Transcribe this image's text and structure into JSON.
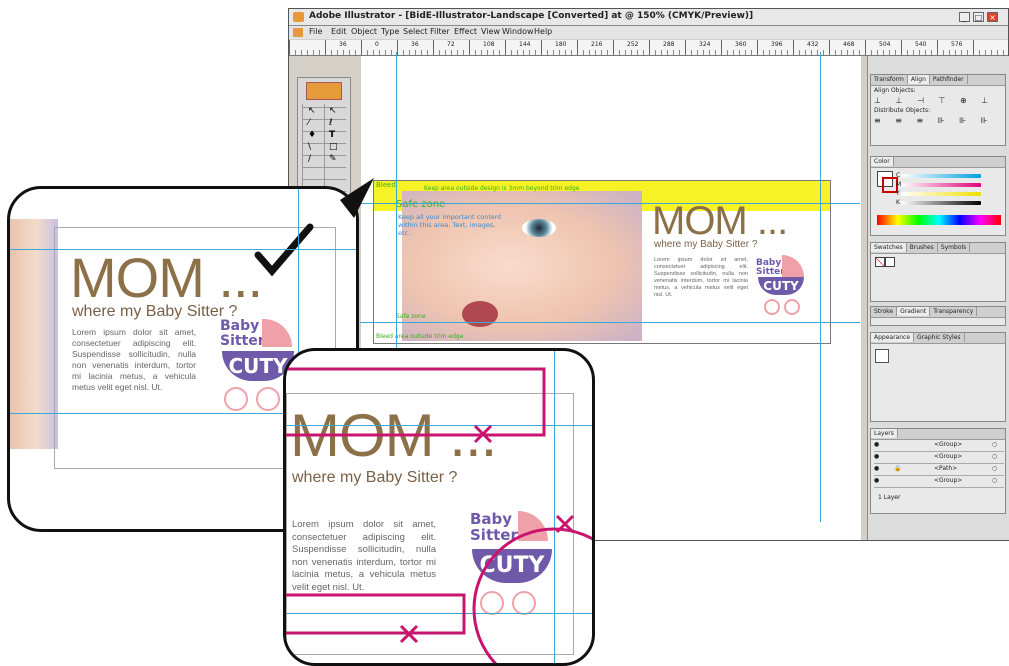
{
  "window": {
    "title": "Adobe Illustrator - [BidE-Illustrator-Landscape [Converted] at @ 150% (CMYK/Preview)]",
    "menus": [
      "File",
      "Edit",
      "Object",
      "Type",
      "Select",
      "Filter",
      "Effect",
      "View",
      "Window",
      "Help"
    ],
    "ruler_ticks": [
      "36",
      "0",
      "36",
      "72",
      "108",
      "144",
      "180",
      "216",
      "252",
      "288",
      "324",
      "360",
      "396",
      "432",
      "468",
      "504",
      "540",
      "576"
    ]
  },
  "panels": {
    "align": {
      "tabs": [
        "Transform",
        "Align",
        "Pathfinder"
      ],
      "align_objects": "Align Objects:",
      "distribute_objects": "Distribute Objects:"
    },
    "color": {
      "tab": "Color",
      "channels": [
        "C",
        "M",
        "Y",
        "K"
      ]
    },
    "swatches": {
      "tabs": [
        "Swatches",
        "Brushes",
        "Symbols"
      ]
    },
    "stroke": {
      "tabs": [
        "Stroke",
        "Gradient",
        "Transparency"
      ]
    },
    "appearance": {
      "tabs": [
        "Appearance",
        "Graphic Styles"
      ]
    },
    "layers": {
      "tab": "Layers",
      "rows": [
        "<Group>",
        "<Group>",
        "<Path>",
        "<Group>"
      ],
      "footer": "1 Layer"
    }
  },
  "artwork": {
    "title": "MOM ...",
    "tagline": "where my Baby Sitter ?",
    "body": "Lorem ipsum dolor sit amet, consectetuer adipiscing elit. Suspendisse sollicitudin, nulla non venenatis interdum, tortor mi lacinia metus, a vehicula metus velit eget nisl. Ut.",
    "logo_line1": "Baby",
    "logo_line2": "Sitter",
    "logo_word": "CUTY",
    "bleed_label": "Bleed",
    "safe_zone_label": "Safe zone",
    "safe_zone_text": "Keep all your important content within this area. Text, images, etc.",
    "bleed_note": "Keep area outside design is 3mm beyond trim edge",
    "zone_small_a": "Safe zone",
    "zone_small_b": "Bleed area outside trim edge"
  },
  "colors": {
    "guide": "#38a8d8",
    "bleed_yellow": "#f4f000",
    "safe_green": "#38b01a",
    "mom_brown": "#8c7048",
    "logo_purple": "#6e5aa8",
    "logo_pink": "#f0a0a8",
    "mark_magenta": "#c8146e"
  },
  "icons": [
    "checkmark-icon",
    "cross-mark-icon",
    "adobe-logo-icon",
    "stroller-logo-icon"
  ]
}
